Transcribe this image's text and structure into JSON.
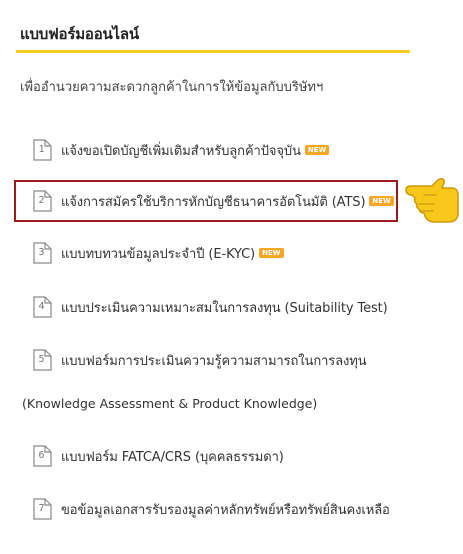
{
  "header": {
    "title": "แบบฟอร์มออนไลน์",
    "subtitle": "เพื่ออำนวยความสะดวกลูกค้าในการให้ข้อมูลกับบริษัทฯ"
  },
  "colors": {
    "accent": "#f6cd1e",
    "new_badge": "#f5a623",
    "highlight_border": "#9b1c1c",
    "hand": "#f7c81a"
  },
  "badge_label": "NEW",
  "forms": [
    {
      "number": "1",
      "label": "แจ้งขอเปิดบัญชีเพิ่มเติมสำหรับลูกค้าปัจจุบัน",
      "is_new": true
    },
    {
      "number": "2",
      "label": "แจ้งการสมัครใช้บริการหักบัญชีธนาคารอัตโนมัติ (ATS)",
      "is_new": true,
      "highlighted": true
    },
    {
      "number": "3",
      "label": "แบบทบทวนข้อมูลประจำปี (E-KYC)",
      "is_new": true
    },
    {
      "number": "4",
      "label": "แบบประเมินความเหมาะสมในการลงทุน (Suitability Test)",
      "is_new": false
    },
    {
      "number": "5",
      "label": "แบบฟอร์มการประเมินความรู้ความสามารถในการลงทุน",
      "is_new": false,
      "continuation": "(Knowledge Assessment & Product Knowledge)"
    },
    {
      "number": "6",
      "label": "แบบฟอร์ม FATCA/CRS (บุคคลธรรมดา)",
      "is_new": false
    },
    {
      "number": "7",
      "label": "ขอข้อมูลเอกสารรับรองมูลค่าหลักทรัพย์หรือทรัพย์สินคงเหลือ",
      "is_new": false
    }
  ]
}
